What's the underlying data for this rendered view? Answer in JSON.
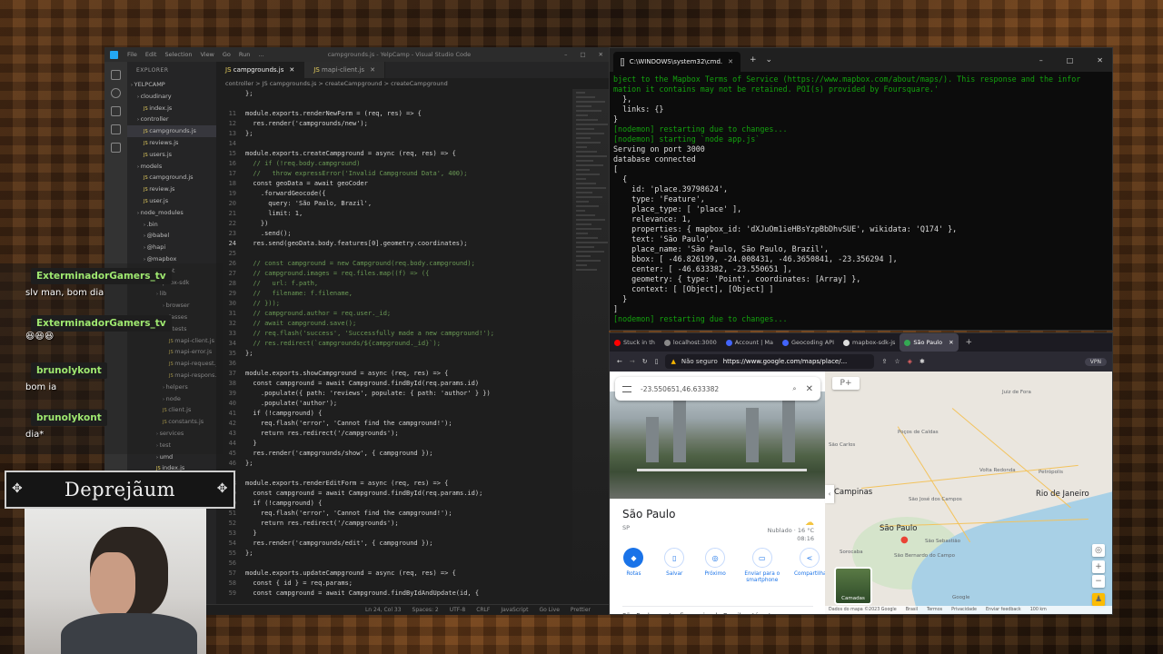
{
  "vscode": {
    "title": "campgrounds.js - YelpCamp - Visual Studio Code",
    "menu": [
      "File",
      "Edit",
      "Selection",
      "View",
      "Go",
      "Run",
      "..."
    ],
    "explorer_header": "EXPLORER",
    "tree": [
      {
        "label": "YELPCAMP",
        "indent": 0,
        "js": false
      },
      {
        "label": "cloudinary",
        "indent": 1,
        "js": false
      },
      {
        "label": "index.js",
        "indent": 2,
        "js": true
      },
      {
        "label": "controller",
        "indent": 1,
        "js": false
      },
      {
        "label": "campgrounds.js",
        "indent": 2,
        "js": true,
        "selected": true
      },
      {
        "label": "reviews.js",
        "indent": 2,
        "js": true
      },
      {
        "label": "users.js",
        "indent": 2,
        "js": true
      },
      {
        "label": "models",
        "indent": 1,
        "js": false
      },
      {
        "label": "campground.js",
        "indent": 2,
        "js": true
      },
      {
        "label": "review.js",
        "indent": 2,
        "js": true
      },
      {
        "label": "user.js",
        "indent": 2,
        "js": true
      },
      {
        "label": "node_modules",
        "indent": 1,
        "js": false
      },
      {
        "label": ".bin",
        "indent": 2,
        "js": false
      },
      {
        "label": "@babel",
        "indent": 2,
        "js": false
      },
      {
        "label": "@hapi",
        "indent": 2,
        "js": false
      },
      {
        "label": "@mapbox",
        "indent": 2,
        "js": false
      },
      {
        "label": "fusspot",
        "indent": 3,
        "js": false
      },
      {
        "label": "mapbox-sdk",
        "indent": 3,
        "js": false
      },
      {
        "label": "lib",
        "indent": 4,
        "js": false
      },
      {
        "label": "browser",
        "indent": 5,
        "js": false
      },
      {
        "label": "classes",
        "indent": 5,
        "js": false
      },
      {
        "label": "tests",
        "indent": 6,
        "js": false
      },
      {
        "label": "mapi-client.js",
        "indent": 6,
        "js": true
      },
      {
        "label": "mapi-error.js",
        "indent": 6,
        "js": true
      },
      {
        "label": "mapi-request.js",
        "indent": 6,
        "js": true
      },
      {
        "label": "mapi-respons...",
        "indent": 6,
        "js": true
      },
      {
        "label": "helpers",
        "indent": 5,
        "js": false
      },
      {
        "label": "node",
        "indent": 5,
        "js": false
      },
      {
        "label": "client.js",
        "indent": 5,
        "js": true
      },
      {
        "label": "constants.js",
        "indent": 5,
        "js": true
      },
      {
        "label": "services",
        "indent": 4,
        "js": false
      },
      {
        "label": "test",
        "indent": 4,
        "js": false
      },
      {
        "label": "umd",
        "indent": 4,
        "js": false
      },
      {
        "label": "index.js",
        "indent": 4,
        "js": true
      }
    ],
    "tabs": [
      {
        "label": "campgrounds.js",
        "active": true
      },
      {
        "label": "mapi-client.js",
        "active": false
      }
    ],
    "breadcrumb": "controller > JS campgrounds.js > createCampground > createCampground",
    "code": [
      {
        "n": "",
        "t": "};",
        "k": "tx"
      },
      {
        "n": "",
        "t": "",
        "k": "tx"
      },
      {
        "n": "11",
        "t": "module.exports.renderNewForm = (req, res) => {",
        "k": "tx"
      },
      {
        "n": "12",
        "t": "  res.render('campgrounds/new');",
        "k": "tx"
      },
      {
        "n": "13",
        "t": "};",
        "k": "tx"
      },
      {
        "n": "14",
        "t": "",
        "k": "tx"
      },
      {
        "n": "15",
        "t": "module.exports.createCampground = async (req, res) => {",
        "k": "tx"
      },
      {
        "n": "16",
        "t": "  // if (!req.body.campground)",
        "k": "cm"
      },
      {
        "n": "17",
        "t": "  //   throw expressError('Invalid Campground Data', 400);",
        "k": "cm"
      },
      {
        "n": "18",
        "t": "  const geoData = await geoCoder",
        "k": "tx"
      },
      {
        "n": "19",
        "t": "    .forwardGeocode({",
        "k": "tx"
      },
      {
        "n": "20",
        "t": "      query: 'São Paulo, Brazil',",
        "k": "tx"
      },
      {
        "n": "21",
        "t": "      limit: 1,",
        "k": "tx"
      },
      {
        "n": "22",
        "t": "    })",
        "k": "tx"
      },
      {
        "n": "23",
        "t": "    .send();",
        "k": "tx"
      },
      {
        "n": "24",
        "t": "  res.send(geoData.body.features[0].geometry.coordinates);",
        "k": "tx",
        "cur": true
      },
      {
        "n": "25",
        "t": "",
        "k": "tx"
      },
      {
        "n": "26",
        "t": "  // const campground = new Campground(req.body.campground);",
        "k": "cm"
      },
      {
        "n": "27",
        "t": "  // campground.images = req.files.map((f) => ({",
        "k": "cm"
      },
      {
        "n": "28",
        "t": "  //   url: f.path,",
        "k": "cm"
      },
      {
        "n": "29",
        "t": "  //   filename: f.filename,",
        "k": "cm"
      },
      {
        "n": "30",
        "t": "  // }));",
        "k": "cm"
      },
      {
        "n": "31",
        "t": "  // campground.author = req.user._id;",
        "k": "cm"
      },
      {
        "n": "32",
        "t": "  // await campground.save();",
        "k": "cm"
      },
      {
        "n": "33",
        "t": "  // req.flash('success', 'Successfully made a new campground!');",
        "k": "cm"
      },
      {
        "n": "34",
        "t": "  // res.redirect(`campgrounds/${campground._id}`);",
        "k": "cm"
      },
      {
        "n": "35",
        "t": "};",
        "k": "tx"
      },
      {
        "n": "36",
        "t": "",
        "k": "tx"
      },
      {
        "n": "37",
        "t": "module.exports.showCampground = async (req, res) => {",
        "k": "tx"
      },
      {
        "n": "38",
        "t": "  const campground = await Campground.findById(req.params.id)",
        "k": "tx"
      },
      {
        "n": "39",
        "t": "    .populate({ path: 'reviews', populate: { path: 'author' } })",
        "k": "tx"
      },
      {
        "n": "40",
        "t": "    .populate('author');",
        "k": "tx"
      },
      {
        "n": "41",
        "t": "  if (!campground) {",
        "k": "tx"
      },
      {
        "n": "42",
        "t": "    req.flash('error', 'Cannot find the campground!');",
        "k": "tx"
      },
      {
        "n": "43",
        "t": "    return res.redirect('/campgrounds');",
        "k": "tx"
      },
      {
        "n": "44",
        "t": "  }",
        "k": "tx"
      },
      {
        "n": "45",
        "t": "  res.render('campgrounds/show', { campground });",
        "k": "tx"
      },
      {
        "n": "46",
        "t": "};",
        "k": "tx"
      },
      {
        "n": "47",
        "t": "",
        "k": "tx"
      },
      {
        "n": "48",
        "t": "module.exports.renderEditForm = async (req, res) => {",
        "k": "tx"
      },
      {
        "n": "49",
        "t": "  const campground = await Campground.findById(req.params.id);",
        "k": "tx"
      },
      {
        "n": "50",
        "t": "  if (!campground) {",
        "k": "tx"
      },
      {
        "n": "51",
        "t": "    req.flash('error', 'Cannot find the campground!');",
        "k": "tx"
      },
      {
        "n": "52",
        "t": "    return res.redirect('/campgrounds');",
        "k": "tx"
      },
      {
        "n": "53",
        "t": "  }",
        "k": "tx"
      },
      {
        "n": "54",
        "t": "  res.render('campgrounds/edit', { campground });",
        "k": "tx"
      },
      {
        "n": "55",
        "t": "};",
        "k": "tx"
      },
      {
        "n": "56",
        "t": "",
        "k": "tx"
      },
      {
        "n": "57",
        "t": "module.exports.updateCampground = async (req, res) => {",
        "k": "tx"
      },
      {
        "n": "58",
        "t": "  const { id } = req.params;",
        "k": "tx"
      },
      {
        "n": "59",
        "t": "  const campground = await Campground.findByIdAndUpdate(id, {",
        "k": "tx"
      }
    ],
    "status": [
      "Ln 24, Col 33",
      "Spaces: 2",
      "UTF-8",
      "CRLF",
      "JavaScript",
      "Go Live",
      "Prettier"
    ]
  },
  "terminal": {
    "tab_title": "C:\\WINDOWS\\system32\\cmd.",
    "lines": [
      {
        "t": "bject to the Mapbox Terms of Service (https://www.mapbox.com/about/maps/). This response and the infor",
        "c": "g"
      },
      {
        "t": "mation it contains may not be retained. POI(s) provided by Foursquare.'",
        "c": "g"
      },
      {
        "t": "  },",
        "c": ""
      },
      {
        "t": "  links: {}",
        "c": ""
      },
      {
        "t": "}",
        "c": ""
      },
      {
        "t": "[nodemon] restarting due to changes...",
        "c": "g"
      },
      {
        "t": "[nodemon] starting `node app.js`",
        "c": "g"
      },
      {
        "t": "Serving on port 3000",
        "c": ""
      },
      {
        "t": "database connected",
        "c": ""
      },
      {
        "t": "[",
        "c": ""
      },
      {
        "t": "  {",
        "c": ""
      },
      {
        "t": "    id: 'place.39798624',",
        "c": ""
      },
      {
        "t": "    type: 'Feature',",
        "c": ""
      },
      {
        "t": "    place_type: [ 'place' ],",
        "c": ""
      },
      {
        "t": "    relevance: 1,",
        "c": ""
      },
      {
        "t": "    properties: { mapbox_id: 'dXJuOm1ieHBsYzpBbDhvSUE', wikidata: 'Q174' },",
        "c": ""
      },
      {
        "t": "    text: 'São Paulo',",
        "c": ""
      },
      {
        "t": "    place_name: 'São Paulo, São Paulo, Brazil',",
        "c": ""
      },
      {
        "t": "    bbox: [ -46.826199, -24.008431, -46.3650841, -23.356294 ],",
        "c": ""
      },
      {
        "t": "    center: [ -46.633382, -23.550651 ],",
        "c": ""
      },
      {
        "t": "    geometry: { type: 'Point', coordinates: [Array] },",
        "c": ""
      },
      {
        "t": "    context: [ [Object], [Object] ]",
        "c": ""
      },
      {
        "t": "  }",
        "c": ""
      },
      {
        "t": "]",
        "c": ""
      },
      {
        "t": "[nodemon] restarting due to changes...",
        "c": "g"
      }
    ]
  },
  "browser": {
    "tabs": [
      {
        "label": "Stuck in th",
        "color": "#ff0000"
      },
      {
        "label": "localhost:3000",
        "color": "#888888"
      },
      {
        "label": "Account | Ma",
        "color": "#4264fb"
      },
      {
        "label": "Geocoding API",
        "color": "#4264fb"
      },
      {
        "label": "mapbox-sdk-js",
        "color": "#dddddd"
      },
      {
        "label": "São Paulo",
        "color": "#34a853",
        "active": true
      }
    ],
    "security": "Não seguro",
    "url": "https://www.google.com/maps/place/...",
    "vpn": "VPN",
    "search_value": "-23.550651,46.633382",
    "place_name": "São Paulo",
    "place_state": "SP",
    "weather_cond": "Nublado · 16 °C",
    "weather_time": "08:16",
    "actions": [
      {
        "label": "Rotas",
        "icon": "◆",
        "fill": true
      },
      {
        "label": "Salvar",
        "icon": "▯",
        "fill": false
      },
      {
        "label": "Próximo",
        "icon": "◎",
        "fill": false
      },
      {
        "label": "Enviar para o smartphone",
        "icon": "▭",
        "fill": false
      },
      {
        "label": "Compartilhar",
        "icon": "<",
        "fill": false
      }
    ],
    "description": "São Paulo, centro financeiro do Brasil, está entre as",
    "layers_label": "Camadas",
    "map_labels": [
      {
        "t": "Campinas",
        "cls": "big"
      },
      {
        "t": "São Paulo",
        "cls": "big"
      },
      {
        "t": "Rio de Janeiro",
        "cls": "big"
      },
      {
        "t": "Juiz de Fora",
        "cls": "sm"
      },
      {
        "t": "Volta Redonda",
        "cls": "sm"
      },
      {
        "t": "Petrópolis",
        "cls": "sm"
      },
      {
        "t": "São José dos Campos",
        "cls": "sm"
      },
      {
        "t": "São Carlos",
        "cls": "sm"
      },
      {
        "t": "Poços de Caldas",
        "cls": "sm"
      },
      {
        "t": "Sorocaba",
        "cls": "sm"
      },
      {
        "t": "São Sebastião",
        "cls": "sm"
      },
      {
        "t": "São Bernardo do Campo",
        "cls": "sm"
      },
      {
        "t": "Google",
        "cls": "sm"
      }
    ],
    "footer": [
      "Dados do mapa ©2023 Google",
      "Brasil",
      "Termos",
      "Privacidade",
      "Enviar feedback",
      "100 km"
    ]
  },
  "chat": {
    "messages": [
      {
        "user": "ExterminadorGamers_tv",
        "text": "slv man, bom dia"
      },
      {
        "user": "ExterminadorGamers_tv",
        "text": "😆😆😆"
      },
      {
        "user": "brunolykont",
        "text": "bom ia"
      },
      {
        "user": "brunolykont",
        "text": "dia*"
      }
    ]
  },
  "streamer": {
    "name": "Deprejãum"
  }
}
